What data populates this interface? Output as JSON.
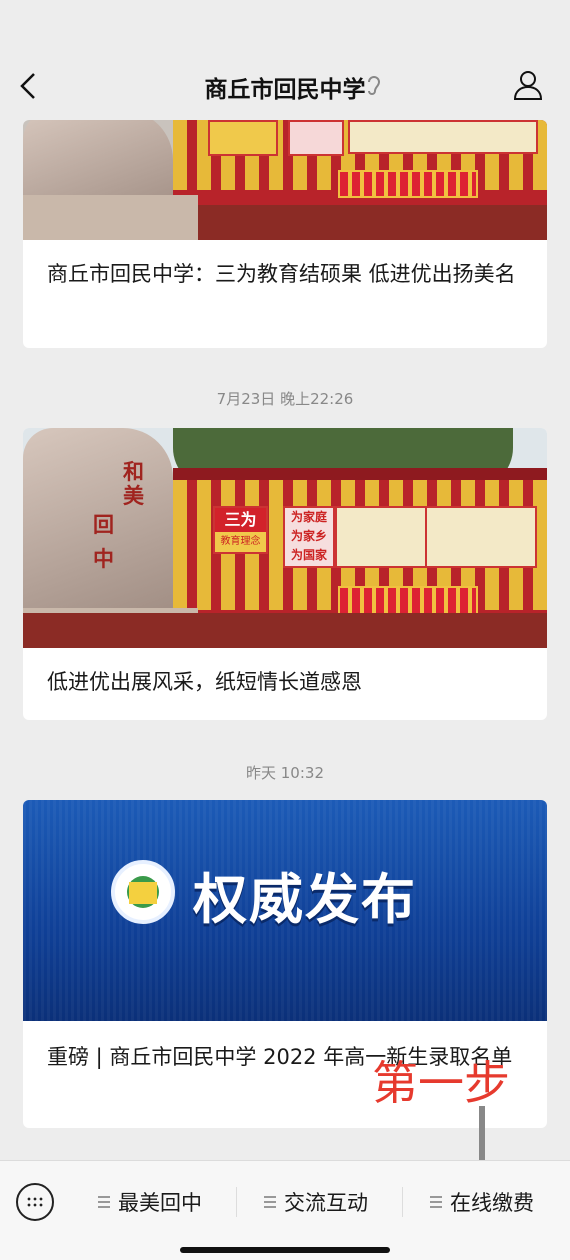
{
  "header": {
    "title": "商丘市回民中学"
  },
  "articles": [
    {
      "title": "商丘市回民中学：三为教育结硕果  低进优出扬美名"
    },
    {
      "timestamp": "7月23日 晚上22:26",
      "title": "低进优出展风采，纸短情长道感恩"
    },
    {
      "timestamp": "昨天 10:32",
      "title": "重磅 | 商丘市回民中学 2022 年高一新生录取名单",
      "banner_text": "权威发布"
    }
  ],
  "banner_texts": {
    "he_mei": "和美",
    "hui_zhong": "回中",
    "zhong": "中",
    "san_wei": "三为",
    "jiaoyu_linian": "教育理念",
    "wei_jia": "为家庭",
    "wei_xiang": "为家乡",
    "wei_guo": "为国家"
  },
  "annotation": "第一步",
  "bottom_menu": [
    {
      "label": "最美回中"
    },
    {
      "label": "交流互动"
    },
    {
      "label": "在线缴费"
    }
  ]
}
